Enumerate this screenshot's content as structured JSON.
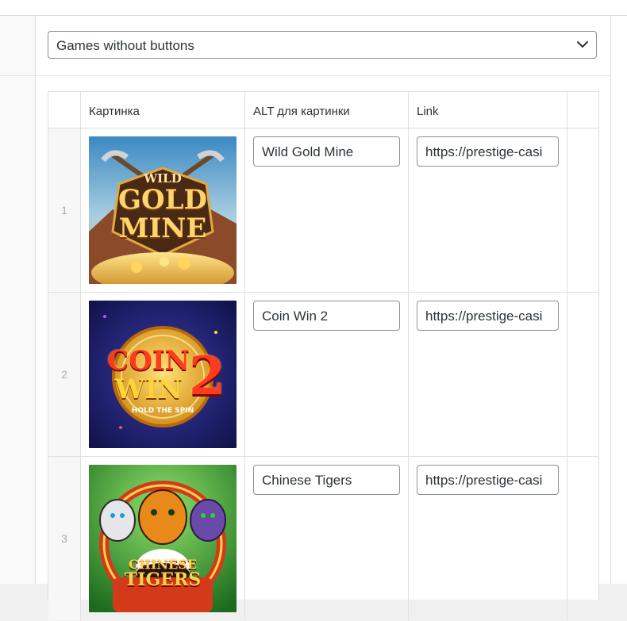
{
  "selector": {
    "value": "Games without buttons"
  },
  "table": {
    "columns": [
      "Картинка",
      "ALT для картинки",
      "Link"
    ],
    "rows": [
      {
        "index": "1",
        "image_name": "wild-gold-mine-thumbnail",
        "image_title_top": "WILD",
        "image_title_mid": "GOLD",
        "image_title_bot": "MINE",
        "alt": "Wild Gold Mine",
        "link": "https://prestige-casi"
      },
      {
        "index": "2",
        "image_name": "coin-win-2-thumbnail",
        "image_title_top": "COIN",
        "image_title_mid": "WIN",
        "image_title_bot": "2",
        "image_caption": "HOLD THE SPIN",
        "alt": "Coin Win 2",
        "link": "https://prestige-casi"
      },
      {
        "index": "3",
        "image_name": "chinese-tigers-thumbnail",
        "image_title_top": "CHINESE",
        "image_title_bot": "TIGERS",
        "alt": "Chinese Tigers",
        "link": "https://prestige-casi"
      }
    ]
  },
  "colors": {
    "border": "#dcdcde",
    "input_border": "#8c8f94",
    "muted_text": "#a7aaad"
  }
}
